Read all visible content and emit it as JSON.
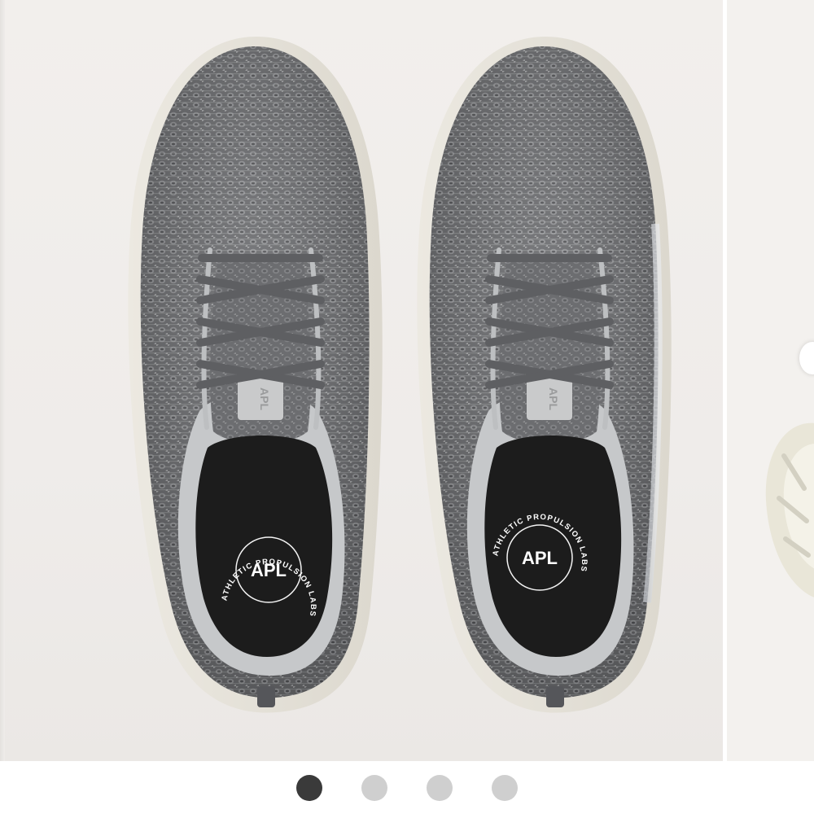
{
  "gallery": {
    "insole_logo": "APL",
    "insole_ring_text": "ATHLETIC PROPULSION LABS",
    "tongue_label": "APL",
    "pager": {
      "count": 4,
      "active_index": 0
    }
  },
  "colors": {
    "background": "#efecea",
    "knit_dark": "#5d5e61",
    "knit_light": "#9a9b9d",
    "lining": "#c9cbcc",
    "sole": "#e9e6de",
    "lace": "#606164",
    "insole": "#1c1c1c",
    "dot_active": "#3a3a3a",
    "dot_inactive": "#cfcfcf"
  }
}
